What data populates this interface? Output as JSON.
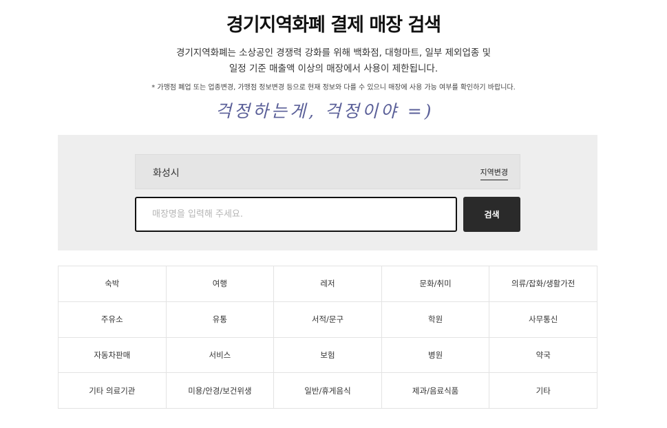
{
  "header": {
    "title": "경기지역화폐 결제 매장 검색",
    "description_line1": "경기지역화폐는 소상공인 경쟁력 강화를 위해 백화점, 대형마트, 일부 제외업종 및",
    "description_line2": "일정 기준 매출액 이상의 매장에서 사용이 제한됩니다.",
    "notice": "* 가맹점 폐업 또는 업종변경, 가맹점 정보변경 등으로 현재 정보와 다를 수 있으니 매장에 사용 가능 여부를 확인하기 바랍니다.",
    "handwriting": "걱정하는게, 걱정이야 =)"
  },
  "search": {
    "region": "화성시",
    "region_change_label": "지역변경",
    "placeholder": "매장명을 입력해 주세요.",
    "button_label": "검색"
  },
  "categories": [
    "숙박",
    "여행",
    "레저",
    "문화/취미",
    "의류/잡화/생활가전",
    "주유소",
    "유통",
    "서적/문구",
    "학원",
    "사무통신",
    "자동차판매",
    "서비스",
    "보험",
    "병원",
    "약국",
    "기타 의료기관",
    "미용/안경/보건위생",
    "일반/휴게음식",
    "제과/음료식품",
    "기타"
  ]
}
